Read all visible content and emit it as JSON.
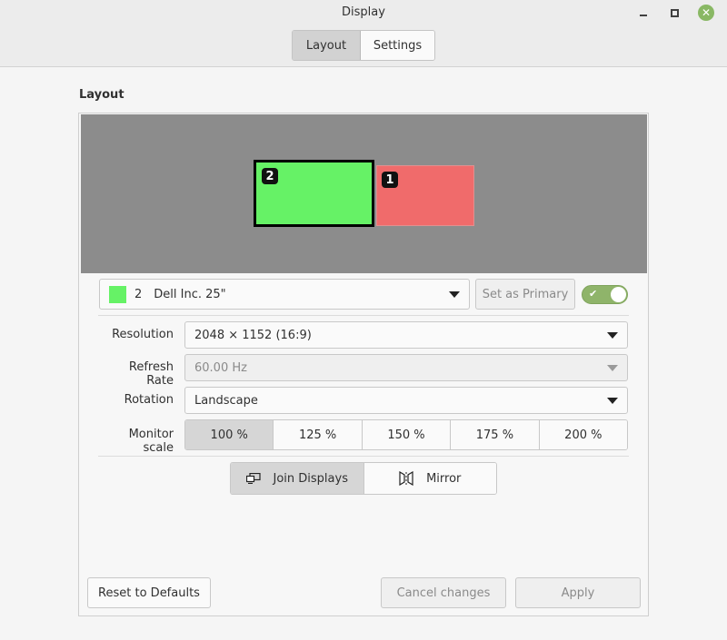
{
  "window": {
    "title": "Display"
  },
  "tabs": [
    {
      "label": "Layout",
      "active": true
    },
    {
      "label": "Settings",
      "active": false
    }
  ],
  "section": {
    "label": "Layout"
  },
  "canvas": {
    "background": "#8c8c8c",
    "monitors": [
      {
        "badge": "2",
        "color": "#66f266",
        "selected": true
      },
      {
        "badge": "1",
        "color": "#f06b6b",
        "selected": false
      }
    ]
  },
  "monitor_select": {
    "swatch_color": "#66f266",
    "number": "2",
    "name": "Dell Inc. 25\""
  },
  "set_primary": {
    "label": "Set as Primary",
    "enabled": false
  },
  "enable_switch": {
    "on": true,
    "color": "#8fb46a"
  },
  "fields": {
    "resolution": {
      "label": "Resolution",
      "value": "2048 × 1152 (16:9)"
    },
    "refresh_rate": {
      "label": "Refresh Rate",
      "value": "60.00 Hz",
      "enabled": false
    },
    "rotation": {
      "label": "Rotation",
      "value": "Landscape"
    },
    "monitor_scale": {
      "label": "Monitor scale",
      "options": [
        "100 %",
        "125 %",
        "150 %",
        "175 %",
        "200 %"
      ],
      "selected": "100 %"
    }
  },
  "modes": {
    "join": {
      "label": "Join Displays",
      "active": true,
      "icon": "join-displays-icon"
    },
    "mirror": {
      "label": "Mirror",
      "active": false,
      "icon": "mirror-icon"
    }
  },
  "footer": {
    "reset_label": "Reset to Defaults",
    "cancel_label": "Cancel changes",
    "apply_label": "Apply"
  }
}
